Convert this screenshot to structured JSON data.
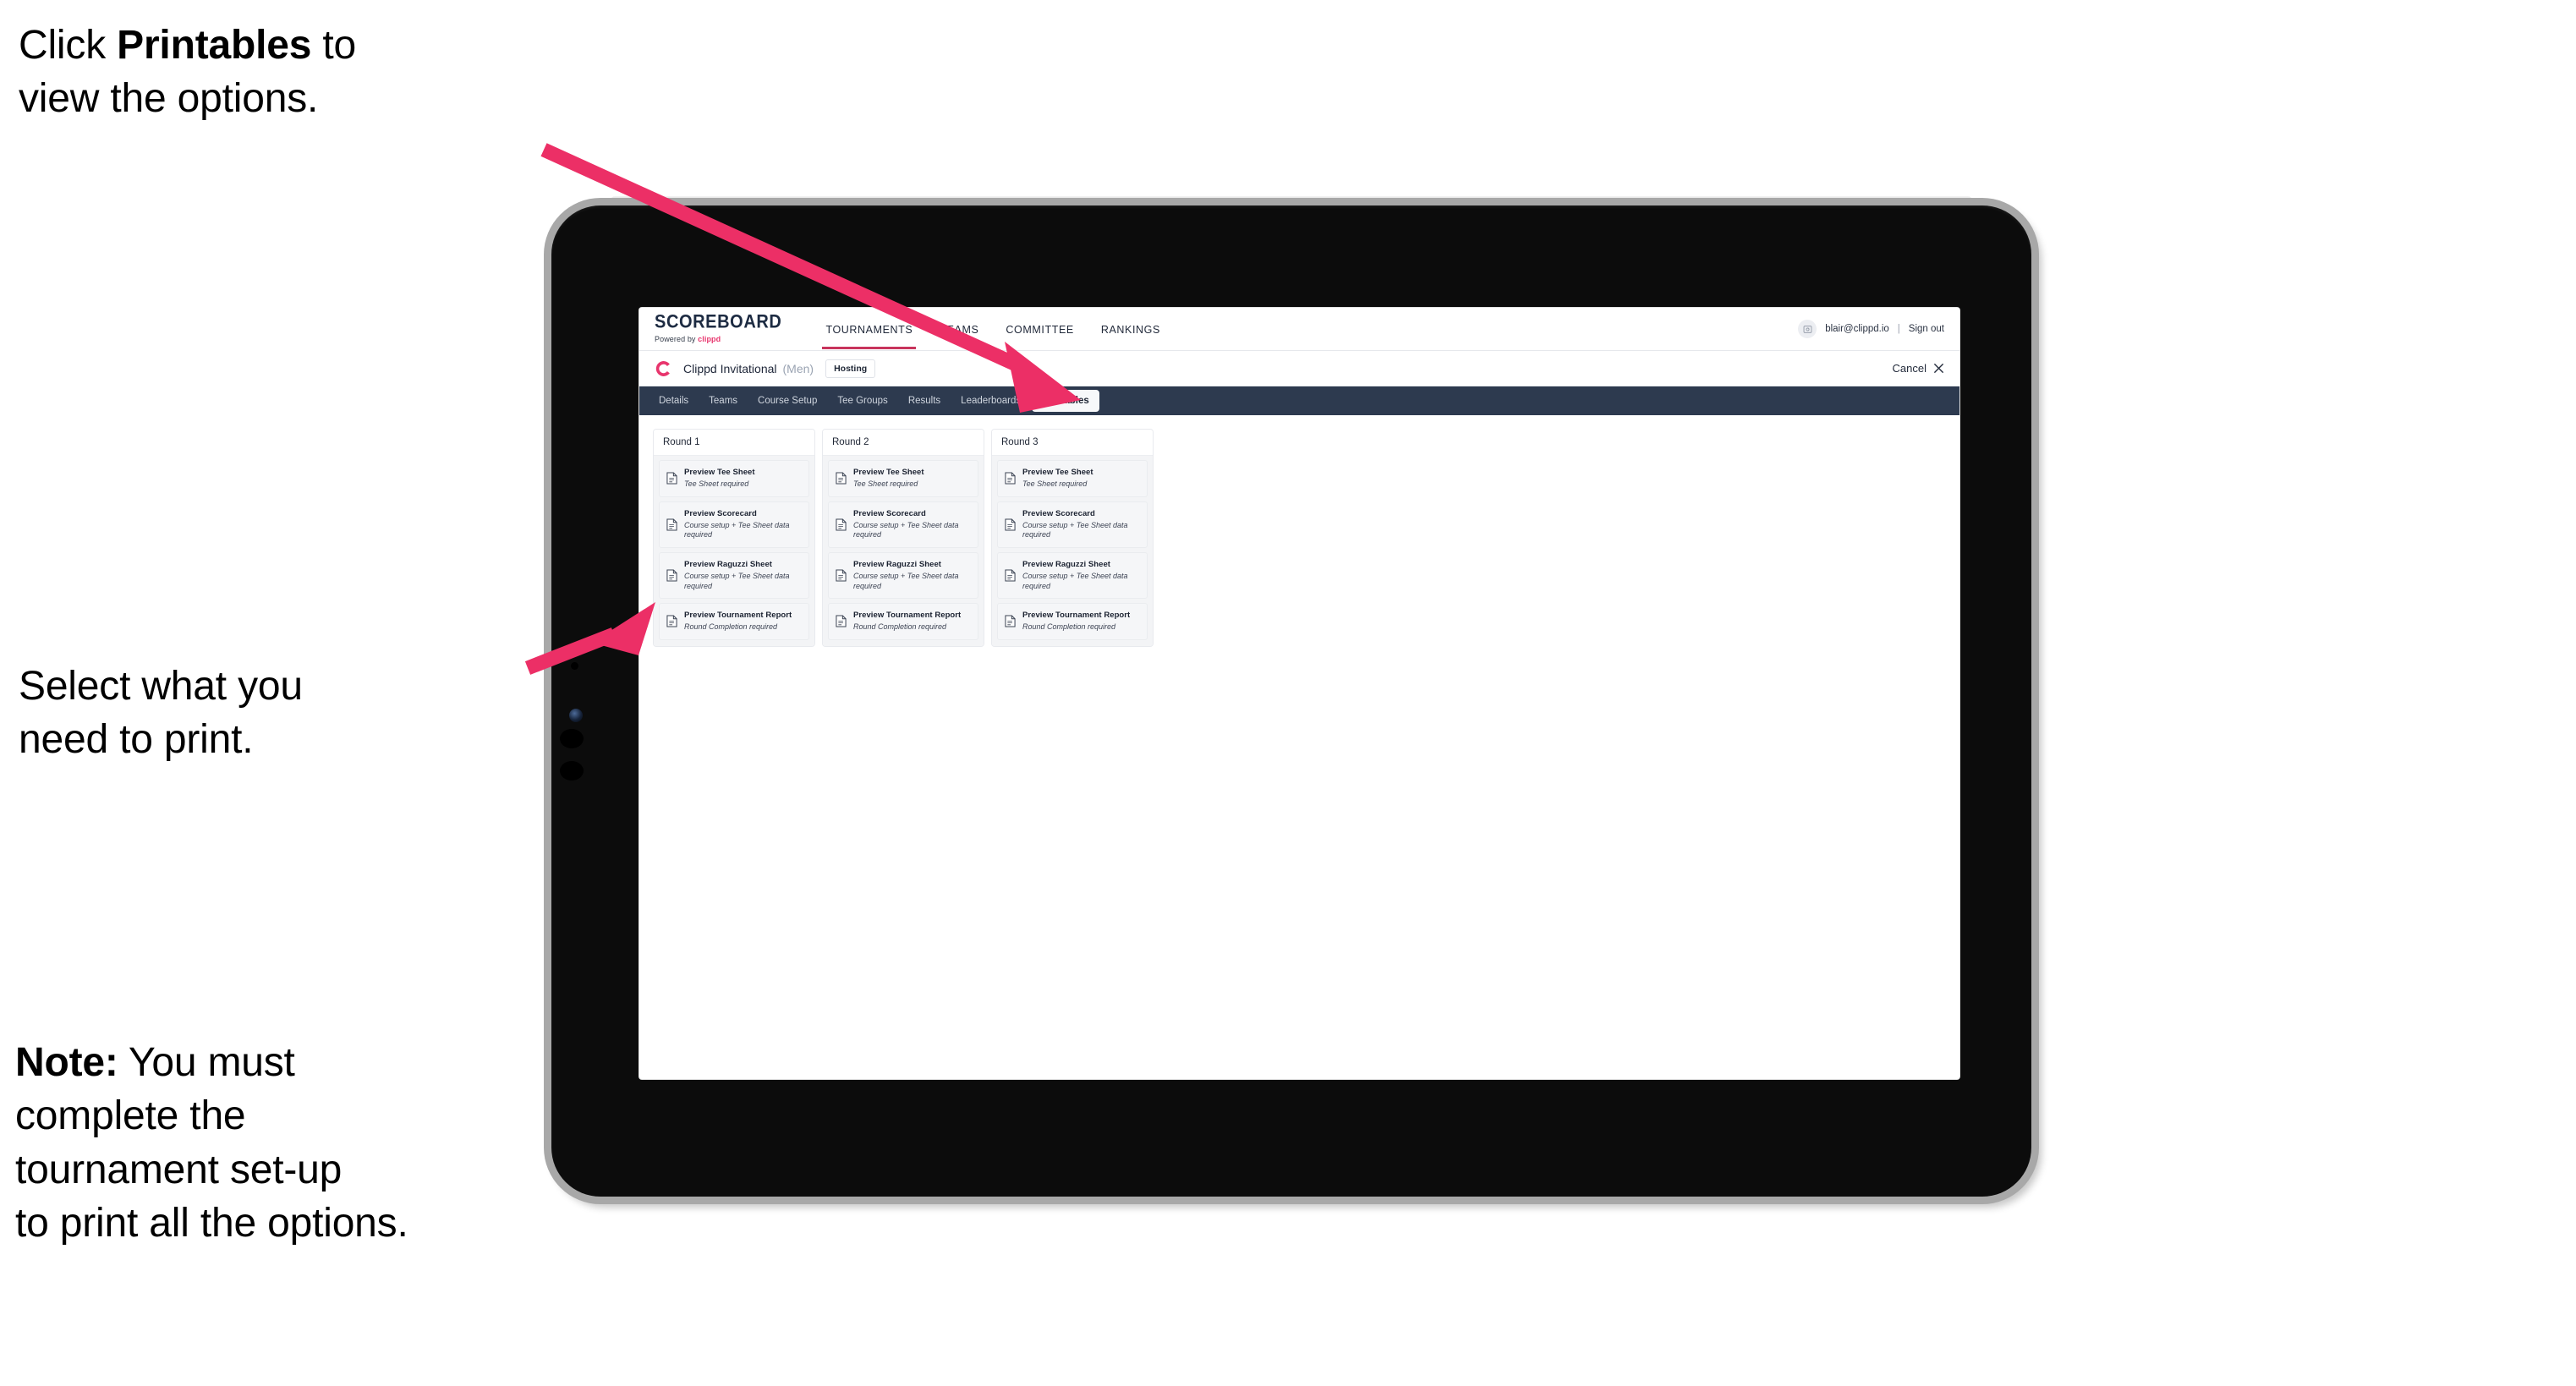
{
  "annotations": {
    "top": {
      "before": "Click ",
      "bold": "Printables",
      "after": " to\nview the options."
    },
    "middle": "Select what you\n need to print.",
    "note": {
      "bold": "Note:",
      "rest": " You must\ncomplete the\ntournament set-up\nto print all the options."
    },
    "arrow_color": "#ec2f66"
  },
  "app": {
    "brand": {
      "title": "SCOREBOARD",
      "sub_prefix": "Powered by ",
      "sub_brand": "clippd"
    },
    "topnav": {
      "links": [
        {
          "label": "TOURNAMENTS",
          "active": true
        },
        {
          "label": "TEAMS",
          "active": false
        },
        {
          "label": "COMMITTEE",
          "active": false
        },
        {
          "label": "RANKINGS",
          "active": false
        }
      ],
      "avatar_icon": "user-avatar-icon",
      "email": "blair@clippd.io",
      "separator": "|",
      "signout": "Sign out"
    },
    "tournament_bar": {
      "logo_icon": "clippd-c-logo-icon",
      "name": "Clippd Invitational",
      "gender": "(Men)",
      "badge": "Hosting",
      "cancel": "Cancel",
      "cancel_icon": "close-x-icon"
    },
    "tabs": [
      {
        "label": "Details",
        "active": false
      },
      {
        "label": "Teams",
        "active": false
      },
      {
        "label": "Course Setup",
        "active": false
      },
      {
        "label": "Tee Groups",
        "active": false
      },
      {
        "label": "Results",
        "active": false
      },
      {
        "label": "Leaderboards",
        "active": false
      },
      {
        "label": "Printables",
        "active": true
      }
    ],
    "rounds": [
      {
        "title": "Round 1",
        "items": [
          {
            "title": "Preview Tee Sheet",
            "sub": "Tee Sheet required",
            "icon": "document-icon"
          },
          {
            "title": "Preview Scorecard",
            "sub": "Course setup + Tee Sheet data required",
            "icon": "document-icon"
          },
          {
            "title": "Preview Raguzzi Sheet",
            "sub": "Course setup + Tee Sheet data required",
            "icon": "document-icon"
          },
          {
            "title": "Preview Tournament Report",
            "sub": "Round Completion required",
            "icon": "document-icon"
          }
        ]
      },
      {
        "title": "Round 2",
        "items": [
          {
            "title": "Preview Tee Sheet",
            "sub": "Tee Sheet required",
            "icon": "document-icon"
          },
          {
            "title": "Preview Scorecard",
            "sub": "Course setup + Tee Sheet data required",
            "icon": "document-icon"
          },
          {
            "title": "Preview Raguzzi Sheet",
            "sub": "Course setup + Tee Sheet data required",
            "icon": "document-icon"
          },
          {
            "title": "Preview Tournament Report",
            "sub": "Round Completion required",
            "icon": "document-icon"
          }
        ]
      },
      {
        "title": "Round 3",
        "items": [
          {
            "title": "Preview Tee Sheet",
            "sub": "Tee Sheet required",
            "icon": "document-icon"
          },
          {
            "title": "Preview Scorecard",
            "sub": "Course setup + Tee Sheet data required",
            "icon": "document-icon"
          },
          {
            "title": "Preview Raguzzi Sheet",
            "sub": "Course setup + Tee Sheet data required",
            "icon": "document-icon"
          },
          {
            "title": "Preview Tournament Report",
            "sub": "Round Completion required",
            "icon": "document-icon"
          }
        ]
      }
    ],
    "colors": {
      "tab_bar": "#2d3a4f",
      "accent_pink": "#e8356d",
      "active_underline": "#c8345c"
    }
  }
}
